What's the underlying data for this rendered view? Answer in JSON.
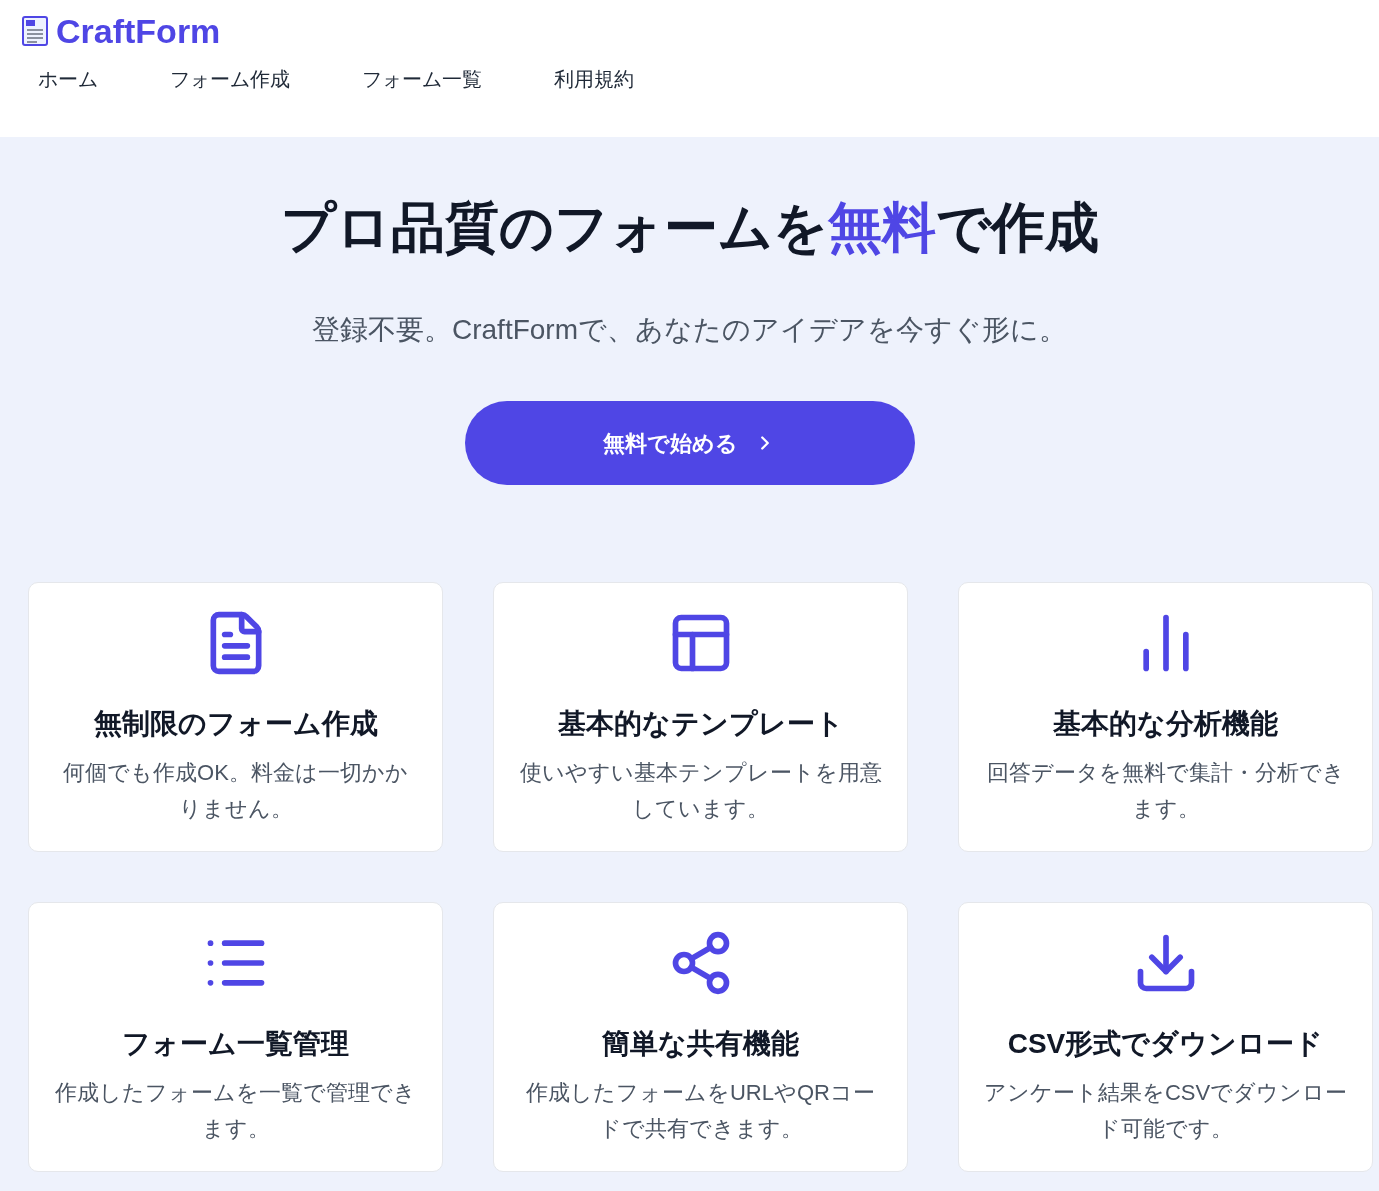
{
  "brand": {
    "name": "CraftForm"
  },
  "nav": [
    {
      "label": "ホーム"
    },
    {
      "label": "フォーム作成"
    },
    {
      "label": "フォーム一覧"
    },
    {
      "label": "利用規約"
    }
  ],
  "hero": {
    "title": "プロ品質のフォームを**無料**で作成",
    "subtitle": "登録不要。CraftFormで、あなたのアイデアを今すぐ形に。",
    "cta": "無料で始める"
  },
  "features": [
    {
      "kind": "document",
      "title": "無制限のフォーム作成",
      "description": "何個でも作成OK。料金は一切かかりません。"
    },
    {
      "kind": "template",
      "title": "基本的なテンプレート",
      "description": "使いやすい基本テンプレートを用意しています。"
    },
    {
      "kind": "chart",
      "title": "基本的な分析機能",
      "description": "回答データを無料で集計・分析できます。"
    },
    {
      "kind": "list",
      "title": "フォーム一覧管理",
      "description": "作成したフォームを一覧で管理できます。"
    },
    {
      "kind": "share",
      "title": "簡単な共有機能",
      "description": "作成したフォームをURLやQRコードで共有できます。"
    },
    {
      "kind": "download",
      "title": "CSV形式でダウンロード",
      "description": "アンケート結果をCSVでダウンロード可能です。"
    }
  ]
}
